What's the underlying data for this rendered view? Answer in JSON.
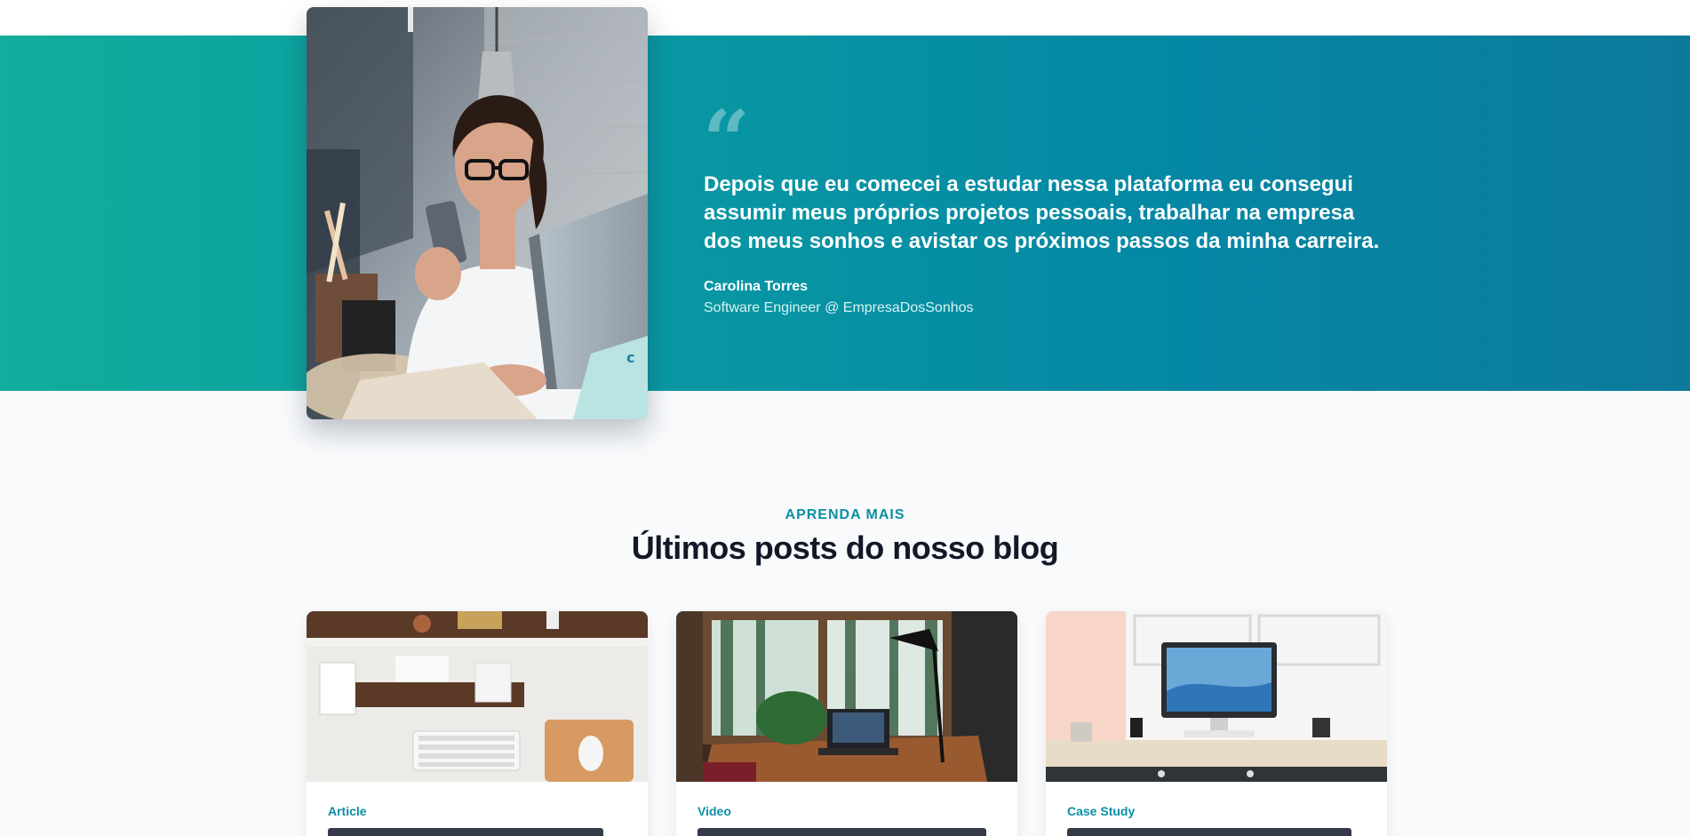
{
  "testimonial": {
    "quote_mark": "“",
    "quote": "Depois que eu comecei a estudar nessa plataforma eu consegui assumir meus próprios projetos pessoais, trabalhar na empresa dos meus sonhos e avistar os próximos passos da minha carreira.",
    "author_name": "Carolina Torres",
    "author_role": "Software Engineer @ EmpresaDosSonhos",
    "colors": {
      "gradient_start": "#12ad9c",
      "gradient_end": "#0d7a9c"
    }
  },
  "blog": {
    "eyebrow": "APRENDA MAIS",
    "title": "Últimos posts do nosso blog",
    "posts": [
      {
        "category": "Article",
        "image": "desk-with-keyboard-photo"
      },
      {
        "category": "Video",
        "image": "laptop-by-window-photo"
      },
      {
        "category": "Case Study",
        "image": "imac-desk-photo"
      }
    ]
  },
  "colors": {
    "accent": "#0b8fa3",
    "heading": "#111827",
    "background": "#f8fafc"
  }
}
